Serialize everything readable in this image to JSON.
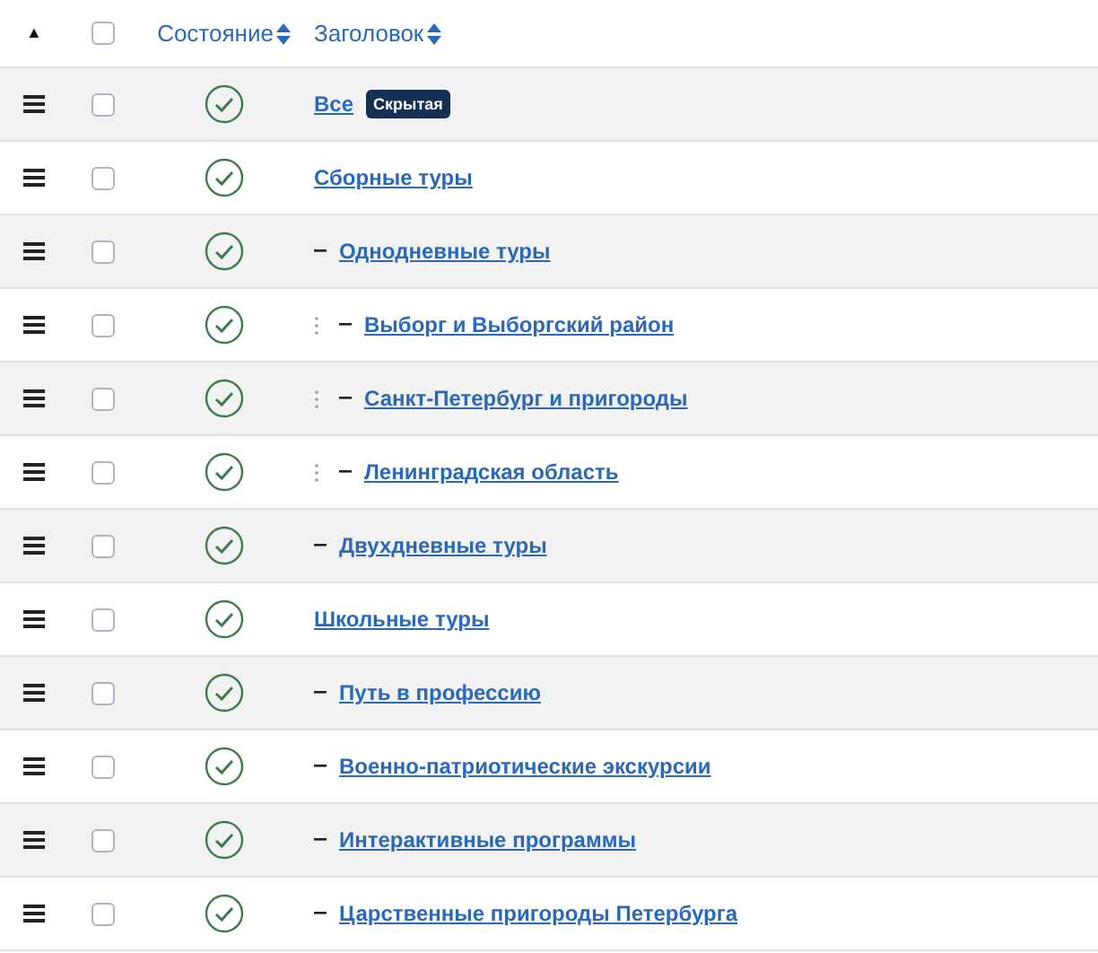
{
  "header": {
    "sort_marker": "▲",
    "columns": [
      {
        "label": "Состояние",
        "sortable": true
      },
      {
        "label": "Заголовок",
        "sortable": true
      }
    ],
    "select_all_checked": false
  },
  "rows": [
    {
      "title": "Все",
      "published": true,
      "checked": false,
      "badge": "Скрытая"
    },
    {
      "title": "Сборные туры",
      "published": true,
      "checked": false,
      "children": [
        {
          "title": "Однодневные туры",
          "published": true,
          "checked": false,
          "children": [
            {
              "title": "Выборг и Выборгский район",
              "published": true,
              "checked": false
            },
            {
              "title": "Санкт-Петербург и пригороды",
              "published": true,
              "checked": false
            },
            {
              "title": "Ленинградская область",
              "published": true,
              "checked": false
            }
          ]
        },
        {
          "title": "Двухдневные туры",
          "published": true,
          "checked": false
        }
      ]
    },
    {
      "title": "Школьные туры",
      "published": true,
      "checked": false,
      "children": [
        {
          "title": "Путь в профессию",
          "published": true,
          "checked": false
        },
        {
          "title": "Военно-патриотические экскурсии",
          "published": true,
          "checked": false
        },
        {
          "title": "Интерактивные программы",
          "published": true,
          "checked": false
        },
        {
          "title": "Царственные пригороды Петербурга",
          "published": true,
          "checked": false
        }
      ]
    }
  ]
}
